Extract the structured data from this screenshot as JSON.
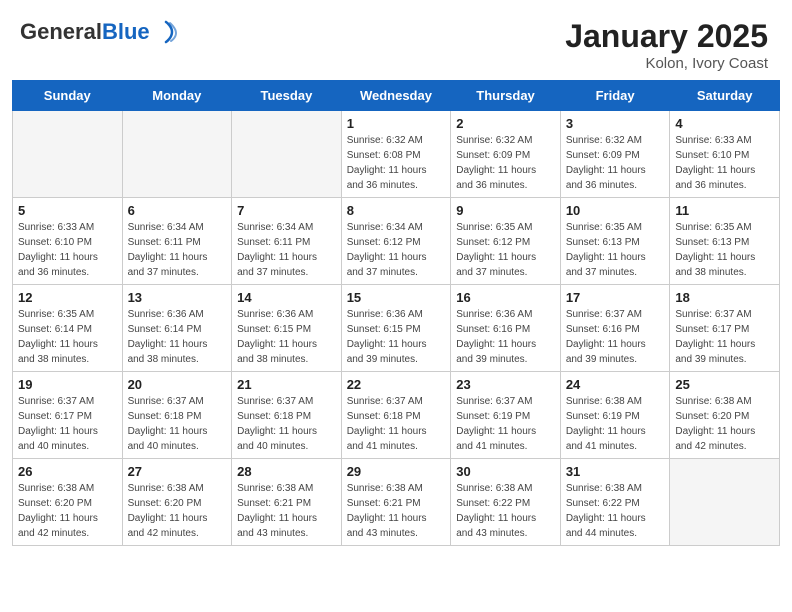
{
  "header": {
    "logo_general": "General",
    "logo_blue": "Blue",
    "month_title": "January 2025",
    "location": "Kolon, Ivory Coast"
  },
  "weekdays": [
    "Sunday",
    "Monday",
    "Tuesday",
    "Wednesday",
    "Thursday",
    "Friday",
    "Saturday"
  ],
  "weeks": [
    [
      {
        "day": "",
        "info": ""
      },
      {
        "day": "",
        "info": ""
      },
      {
        "day": "",
        "info": ""
      },
      {
        "day": "1",
        "info": "Sunrise: 6:32 AM\nSunset: 6:08 PM\nDaylight: 11 hours\nand 36 minutes."
      },
      {
        "day": "2",
        "info": "Sunrise: 6:32 AM\nSunset: 6:09 PM\nDaylight: 11 hours\nand 36 minutes."
      },
      {
        "day": "3",
        "info": "Sunrise: 6:32 AM\nSunset: 6:09 PM\nDaylight: 11 hours\nand 36 minutes."
      },
      {
        "day": "4",
        "info": "Sunrise: 6:33 AM\nSunset: 6:10 PM\nDaylight: 11 hours\nand 36 minutes."
      }
    ],
    [
      {
        "day": "5",
        "info": "Sunrise: 6:33 AM\nSunset: 6:10 PM\nDaylight: 11 hours\nand 36 minutes."
      },
      {
        "day": "6",
        "info": "Sunrise: 6:34 AM\nSunset: 6:11 PM\nDaylight: 11 hours\nand 37 minutes."
      },
      {
        "day": "7",
        "info": "Sunrise: 6:34 AM\nSunset: 6:11 PM\nDaylight: 11 hours\nand 37 minutes."
      },
      {
        "day": "8",
        "info": "Sunrise: 6:34 AM\nSunset: 6:12 PM\nDaylight: 11 hours\nand 37 minutes."
      },
      {
        "day": "9",
        "info": "Sunrise: 6:35 AM\nSunset: 6:12 PM\nDaylight: 11 hours\nand 37 minutes."
      },
      {
        "day": "10",
        "info": "Sunrise: 6:35 AM\nSunset: 6:13 PM\nDaylight: 11 hours\nand 37 minutes."
      },
      {
        "day": "11",
        "info": "Sunrise: 6:35 AM\nSunset: 6:13 PM\nDaylight: 11 hours\nand 38 minutes."
      }
    ],
    [
      {
        "day": "12",
        "info": "Sunrise: 6:35 AM\nSunset: 6:14 PM\nDaylight: 11 hours\nand 38 minutes."
      },
      {
        "day": "13",
        "info": "Sunrise: 6:36 AM\nSunset: 6:14 PM\nDaylight: 11 hours\nand 38 minutes."
      },
      {
        "day": "14",
        "info": "Sunrise: 6:36 AM\nSunset: 6:15 PM\nDaylight: 11 hours\nand 38 minutes."
      },
      {
        "day": "15",
        "info": "Sunrise: 6:36 AM\nSunset: 6:15 PM\nDaylight: 11 hours\nand 39 minutes."
      },
      {
        "day": "16",
        "info": "Sunrise: 6:36 AM\nSunset: 6:16 PM\nDaylight: 11 hours\nand 39 minutes."
      },
      {
        "day": "17",
        "info": "Sunrise: 6:37 AM\nSunset: 6:16 PM\nDaylight: 11 hours\nand 39 minutes."
      },
      {
        "day": "18",
        "info": "Sunrise: 6:37 AM\nSunset: 6:17 PM\nDaylight: 11 hours\nand 39 minutes."
      }
    ],
    [
      {
        "day": "19",
        "info": "Sunrise: 6:37 AM\nSunset: 6:17 PM\nDaylight: 11 hours\nand 40 minutes."
      },
      {
        "day": "20",
        "info": "Sunrise: 6:37 AM\nSunset: 6:18 PM\nDaylight: 11 hours\nand 40 minutes."
      },
      {
        "day": "21",
        "info": "Sunrise: 6:37 AM\nSunset: 6:18 PM\nDaylight: 11 hours\nand 40 minutes."
      },
      {
        "day": "22",
        "info": "Sunrise: 6:37 AM\nSunset: 6:18 PM\nDaylight: 11 hours\nand 41 minutes."
      },
      {
        "day": "23",
        "info": "Sunrise: 6:37 AM\nSunset: 6:19 PM\nDaylight: 11 hours\nand 41 minutes."
      },
      {
        "day": "24",
        "info": "Sunrise: 6:38 AM\nSunset: 6:19 PM\nDaylight: 11 hours\nand 41 minutes."
      },
      {
        "day": "25",
        "info": "Sunrise: 6:38 AM\nSunset: 6:20 PM\nDaylight: 11 hours\nand 42 minutes."
      }
    ],
    [
      {
        "day": "26",
        "info": "Sunrise: 6:38 AM\nSunset: 6:20 PM\nDaylight: 11 hours\nand 42 minutes."
      },
      {
        "day": "27",
        "info": "Sunrise: 6:38 AM\nSunset: 6:20 PM\nDaylight: 11 hours\nand 42 minutes."
      },
      {
        "day": "28",
        "info": "Sunrise: 6:38 AM\nSunset: 6:21 PM\nDaylight: 11 hours\nand 43 minutes."
      },
      {
        "day": "29",
        "info": "Sunrise: 6:38 AM\nSunset: 6:21 PM\nDaylight: 11 hours\nand 43 minutes."
      },
      {
        "day": "30",
        "info": "Sunrise: 6:38 AM\nSunset: 6:22 PM\nDaylight: 11 hours\nand 43 minutes."
      },
      {
        "day": "31",
        "info": "Sunrise: 6:38 AM\nSunset: 6:22 PM\nDaylight: 11 hours\nand 44 minutes."
      },
      {
        "day": "",
        "info": ""
      }
    ]
  ]
}
